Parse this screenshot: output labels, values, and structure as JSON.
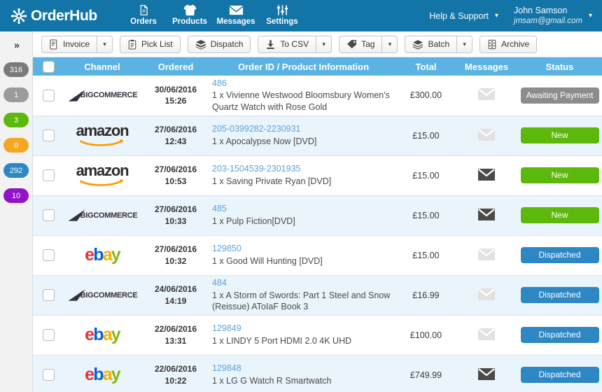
{
  "header": {
    "brand": "OrderHub",
    "brand_icon": "asterisk-burst-logo-icon",
    "nav": [
      {
        "label": "Orders",
        "icon": "document-icon"
      },
      {
        "label": "Products",
        "icon": "tshirt-icon"
      },
      {
        "label": "Messages",
        "icon": "envelope-icon"
      },
      {
        "label": "Settings",
        "icon": "sliders-icon"
      }
    ],
    "help_label": "Help & Support",
    "help_caret": "▾",
    "user_name": "John Samson",
    "user_email": "jmsam@gmail.com",
    "user_caret": "▾",
    "bg_color": "#1274a7"
  },
  "sidebar": {
    "toggle_icon": "double-chevron-right-icon",
    "toggle_glyph": "»",
    "badges": [
      {
        "count": "316",
        "color": "#7a7a7a"
      },
      {
        "count": "1",
        "color": "#9b9b9b"
      },
      {
        "count": "3",
        "color": "#5cb80b"
      },
      {
        "count": "0",
        "color": "#f5a623"
      },
      {
        "count": "292",
        "color": "#2d87c3"
      },
      {
        "count": "10",
        "color": "#9013c7"
      }
    ]
  },
  "toolbar": {
    "buttons": [
      {
        "label": "Invoice",
        "icon": "invoice-document-icon",
        "dropdown": true
      },
      {
        "label": "Pick List",
        "icon": "clipboard-icon",
        "dropdown": false
      },
      {
        "label": "Dispatch",
        "icon": "open-box-icon",
        "dropdown": false
      },
      {
        "label": "To CSV",
        "icon": "download-icon",
        "dropdown": true
      },
      {
        "label": "Tag",
        "icon": "tag-icon",
        "dropdown": true
      },
      {
        "label": "Batch",
        "icon": "layers-icon",
        "dropdown": true
      },
      {
        "label": "Archive",
        "icon": "archive-box-icon",
        "dropdown": false
      }
    ],
    "dropdown_glyph": "▾"
  },
  "table": {
    "header_bg": "#5bb3e4",
    "columns": [
      "",
      "Channel",
      "Ordered",
      "Order ID / Product Information",
      "Total",
      "Messages",
      "Status"
    ],
    "status_colors": {
      "Awaiting Payment": "#8c8c8c",
      "New": "#5cb80b",
      "Dispatched": "#2d87c3"
    },
    "rows": [
      {
        "channel": "bigcommerce",
        "channel_label": "BIGCOMMERCE",
        "date": "30/06/2016",
        "time": "15:26",
        "order_id": "486",
        "product": "1 x Vivienne Westwood Bloomsbury Women's Quartz Watch with Rose Gold",
        "total": "£300.00",
        "message_active": false,
        "status": "Awaiting Payment"
      },
      {
        "channel": "amazon",
        "channel_label": "amazon",
        "date": "27/06/2016",
        "time": "12:43",
        "order_id": "205-0399282-2230931",
        "product": "1 x Apocalypse Now [DVD]",
        "total": "£15.00",
        "message_active": false,
        "status": "New"
      },
      {
        "channel": "amazon",
        "channel_label": "amazon",
        "date": "27/06/2016",
        "time": "10:53",
        "order_id": "203-1504539-2301935",
        "product": "1 x Saving Private Ryan [DVD]",
        "total": "£15.00",
        "message_active": true,
        "status": "New"
      },
      {
        "channel": "bigcommerce",
        "channel_label": "BIGCOMMERCE",
        "date": "27/06/2016",
        "time": "10:33",
        "order_id": "485",
        "product": "1 x Pulp Fiction[DVD]",
        "total": "£15.00",
        "message_active": true,
        "status": "New"
      },
      {
        "channel": "ebay",
        "channel_label": "ebay",
        "date": "27/06/2016",
        "time": "10:32",
        "order_id": "129850",
        "product": "1 x Good Will Hunting [DVD]",
        "total": "£15.00",
        "message_active": false,
        "status": "Dispatched"
      },
      {
        "channel": "bigcommerce",
        "channel_label": "BIGCOMMERCE",
        "date": "24/06/2016",
        "time": "14:19",
        "order_id": "484",
        "product": "1 x A Storm of Swords: Part 1 Steel and Snow (Reissue) AToIaF Book 3",
        "total": "£16.99",
        "message_active": false,
        "status": "Dispatched"
      },
      {
        "channel": "ebay",
        "channel_label": "ebay",
        "date": "22/06/2016",
        "time": "13:31",
        "order_id": "129849",
        "product": "1 x LINDY 5 Port HDMI 2.0 4K UHD",
        "total": "£100.00",
        "message_active": false,
        "status": "Dispatched"
      },
      {
        "channel": "ebay",
        "channel_label": "ebay",
        "date": "22/06/2016",
        "time": "10:22",
        "order_id": "129848",
        "product": "1 x LG G Watch R Smartwatch",
        "total": "£749.99",
        "message_active": true,
        "status": "Dispatched"
      }
    ]
  }
}
